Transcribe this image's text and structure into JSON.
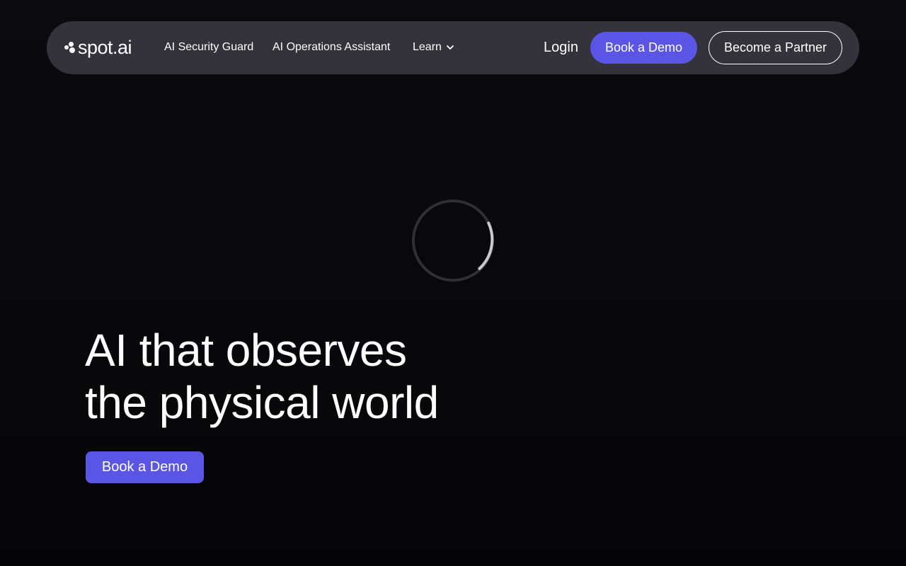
{
  "nav": {
    "logo_text": "spot.ai",
    "links": [
      {
        "label": "AI Security Guard"
      },
      {
        "label": "AI Operations Assistant"
      },
      {
        "label": "Learn"
      }
    ],
    "login_label": "Login",
    "book_demo_label": "Book a Demo",
    "partner_label": "Become a Partner"
  },
  "hero": {
    "title_line1": "AI that observes",
    "title_line2": "the physical world",
    "cta_label": "Book a Demo"
  },
  "loading_spinner": {
    "visible": true
  },
  "colors": {
    "background": "#08080b",
    "nav_background": "#34333b",
    "accent": "#5b55e6",
    "text": "#ffffff"
  }
}
